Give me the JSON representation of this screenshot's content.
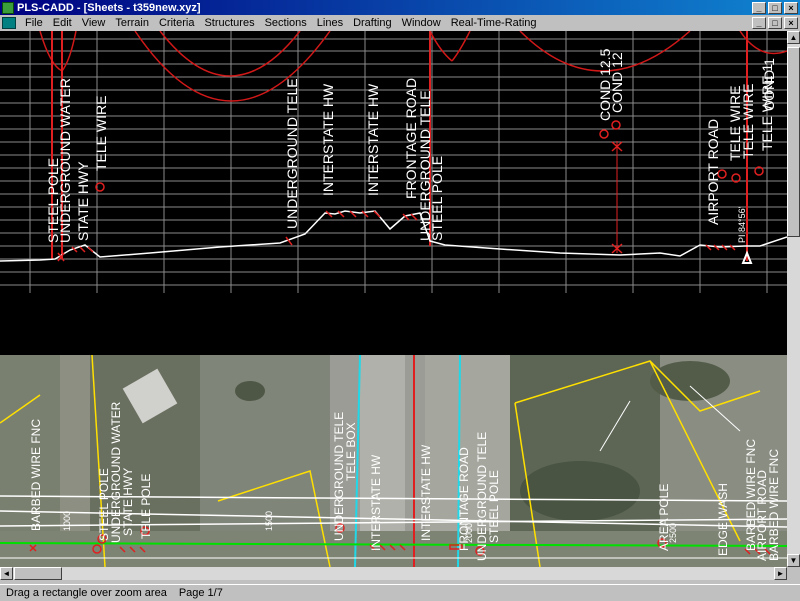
{
  "window": {
    "title": "PLS-CADD - [Sheets - t359new.xyz]",
    "minimize": "_",
    "maximize": "□",
    "close": "×"
  },
  "menu": {
    "items": [
      "File",
      "Edit",
      "View",
      "Terrain",
      "Criteria",
      "Structures",
      "Sections",
      "Lines",
      "Drafting",
      "Window",
      "Real-Time-Rating"
    ]
  },
  "profile": {
    "labels": {
      "steel_pole_1": "STEEL POLE",
      "underground_water": "UNDERGROUND WATER",
      "state_hwy": "STATE HWY",
      "tele_wire_1": "TELE WIRE",
      "underground_tele_1": "UNDERGROUND TELE",
      "interstate_hw_1": "INTERSTATE HW",
      "interstate_hw_2": "INTERSTATE HW",
      "frontage_road": "FRONTAGE ROAD",
      "underground_tele_2": "UNDERGROUND TELE",
      "steel_pole_2": "STEEL POLE",
      "cond_12_5": "COND 12.5",
      "cond_12": "COND 12",
      "airport_road": "AIRPORT ROAD",
      "tele_wire_2": "TELE WIRE",
      "tele_wire_3": "TELE WIRE",
      "cond_1": "COND 1",
      "tele_wire_4": "TELE WIRE 1",
      "pi_angle": "PI 84°56'"
    }
  },
  "plan": {
    "labels": {
      "barbed_wire_fnc_1": "BARBED WIRE FNC",
      "steel_pole": "STEEL POLE",
      "underground_water": "UNDERGROUND WATER",
      "state_hwy": "STATE HWY",
      "tele_pole": "TELE POLE",
      "underground_tele_1": "UNDERGROUND TELE",
      "tele_box": "TELE BOX",
      "interstate_hw_1": "INTERSTATE HW",
      "interstate_hw_2": "INTERSTATE HW",
      "frontage_road": "FRONTAGE ROAD",
      "underground_tele_2": "UNDERGROUND TELE",
      "steel_pole_2": "STEEL POLE",
      "area_pole": "AREA POLE",
      "edge_wash": "EDGE WASH",
      "barbed_wire_fnc_2": "BARBED WIRE FNC",
      "airport_road": "AIRPORT ROAD",
      "barbed_wire_fnc_3": "BARBED WIRE FNC",
      "station_1000": "1000",
      "station_1500": "1500",
      "station_2000": "2000",
      "station_2500": "2500"
    }
  },
  "status": {
    "hint": "Drag a rectangle over zoom area",
    "page": "Page 1/7"
  }
}
